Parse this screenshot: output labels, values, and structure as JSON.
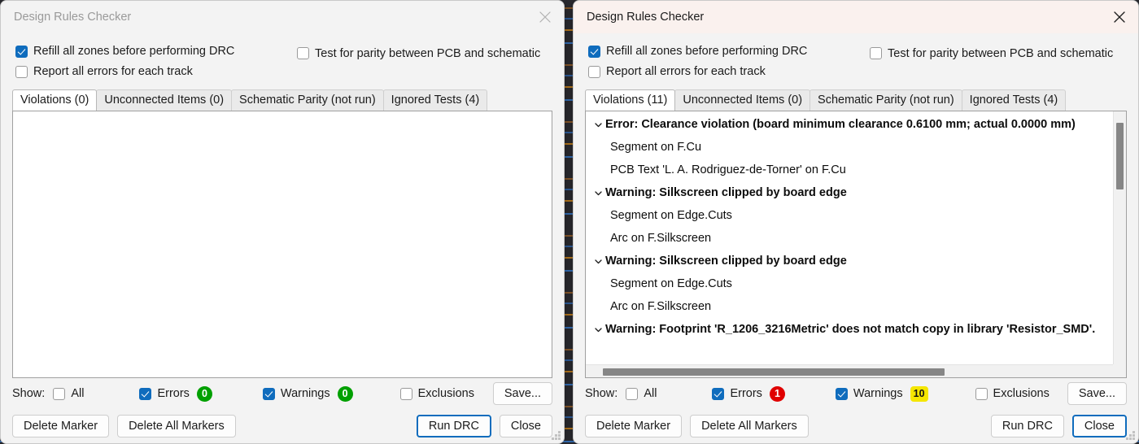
{
  "window_title": "Design Rules Checker",
  "icons": {
    "close": "close-icon",
    "chevron_down": "chevron-down-icon"
  },
  "colors": {
    "accent": "#0f6cbd",
    "badge_zero": "#00a000",
    "badge_error": "#e00000",
    "badge_warning": "#f5e600",
    "active_titlebar": "#faf1ee",
    "inactive_titlebar": "#f3f3f3"
  },
  "options": {
    "refill_zones": "Refill all zones before performing DRC",
    "test_parity": "Test for parity between PCB and schematic",
    "report_all_errors": "Report all errors for each track"
  },
  "left": {
    "title": "Design Rules Checker",
    "active": false,
    "tabs": [
      {
        "label": "Violations (0)",
        "selected": true
      },
      {
        "label": "Unconnected Items (0)",
        "selected": false
      },
      {
        "label": "Schematic Parity (not run)",
        "selected": false
      },
      {
        "label": "Ignored Tests (4)",
        "selected": false
      }
    ],
    "violations": [],
    "show": {
      "label": "Show:",
      "all": "All",
      "errors": "Errors",
      "errors_count": "0",
      "errors_badge": "zero",
      "warnings": "Warnings",
      "warnings_count": "0",
      "warnings_badge": "zero",
      "exclusions": "Exclusions"
    },
    "buttons": {
      "save": "Save...",
      "delete_marker": "Delete Marker",
      "delete_all_markers": "Delete All Markers",
      "run_drc": "Run DRC",
      "close": "Close",
      "default_button": "run_drc"
    }
  },
  "right": {
    "title": "Design Rules Checker",
    "active": true,
    "tabs": [
      {
        "label": "Violations (11)",
        "selected": true
      },
      {
        "label": "Unconnected Items (0)",
        "selected": false
      },
      {
        "label": "Schematic Parity (not run)",
        "selected": false
      },
      {
        "label": "Ignored Tests (4)",
        "selected": false
      }
    ],
    "violations": [
      {
        "level": "parent",
        "text": "Error: Clearance violation (board minimum clearance 0.6100 mm; actual 0.0000 mm)"
      },
      {
        "level": "child",
        "text": "Segment on F.Cu"
      },
      {
        "level": "child",
        "text": "PCB Text 'L. A. Rodriguez-de-Torner' on F.Cu"
      },
      {
        "level": "parent",
        "text": "Warning: Silkscreen clipped by board edge"
      },
      {
        "level": "child",
        "text": "Segment on Edge.Cuts"
      },
      {
        "level": "child",
        "text": "Arc on F.Silkscreen"
      },
      {
        "level": "parent",
        "text": "Warning: Silkscreen clipped by board edge"
      },
      {
        "level": "child",
        "text": "Segment on Edge.Cuts"
      },
      {
        "level": "child",
        "text": "Arc on F.Silkscreen"
      },
      {
        "level": "parent",
        "text": "Warning: Footprint 'R_1206_3216Metric' does not match copy in library 'Resistor_SMD'."
      }
    ],
    "show": {
      "label": "Show:",
      "all": "All",
      "errors": "Errors",
      "errors_count": "1",
      "errors_badge": "err",
      "warnings": "Warnings",
      "warnings_count": "10",
      "warnings_badge": "warn",
      "exclusions": "Exclusions"
    },
    "buttons": {
      "save": "Save...",
      "delete_marker": "Delete Marker",
      "delete_all_markers": "Delete All Markers",
      "run_drc": "Run DRC",
      "close": "Close",
      "default_button": "close"
    }
  }
}
